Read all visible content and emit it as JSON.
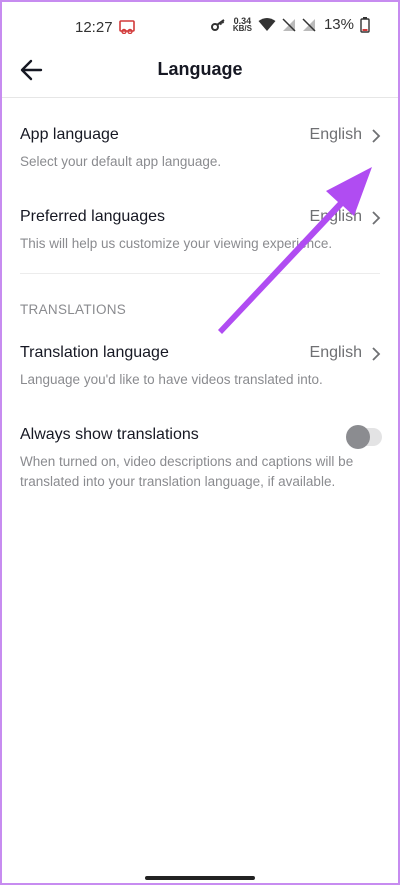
{
  "status_bar": {
    "time": "12:27",
    "net_speed_value": "0.34",
    "net_speed_unit": "KB/S",
    "battery": "13%"
  },
  "header": {
    "title": "Language"
  },
  "settings": {
    "app_language": {
      "title": "App language",
      "value": "English",
      "description": "Select your default app language."
    },
    "preferred_languages": {
      "title": "Preferred languages",
      "value": "English",
      "description": "This will help us customize your viewing experience."
    },
    "translations_section": "TRANSLATIONS",
    "translation_language": {
      "title": "Translation language",
      "value": "English",
      "description": "Language you'd like to have videos translated into."
    },
    "always_show_translations": {
      "title": "Always show translations",
      "enabled": false,
      "description": "When turned on, video descriptions and captions will be translated into your translation language, if available."
    }
  },
  "colors": {
    "annotation_arrow": "#b04cf2",
    "frame": "#c78cf0"
  }
}
